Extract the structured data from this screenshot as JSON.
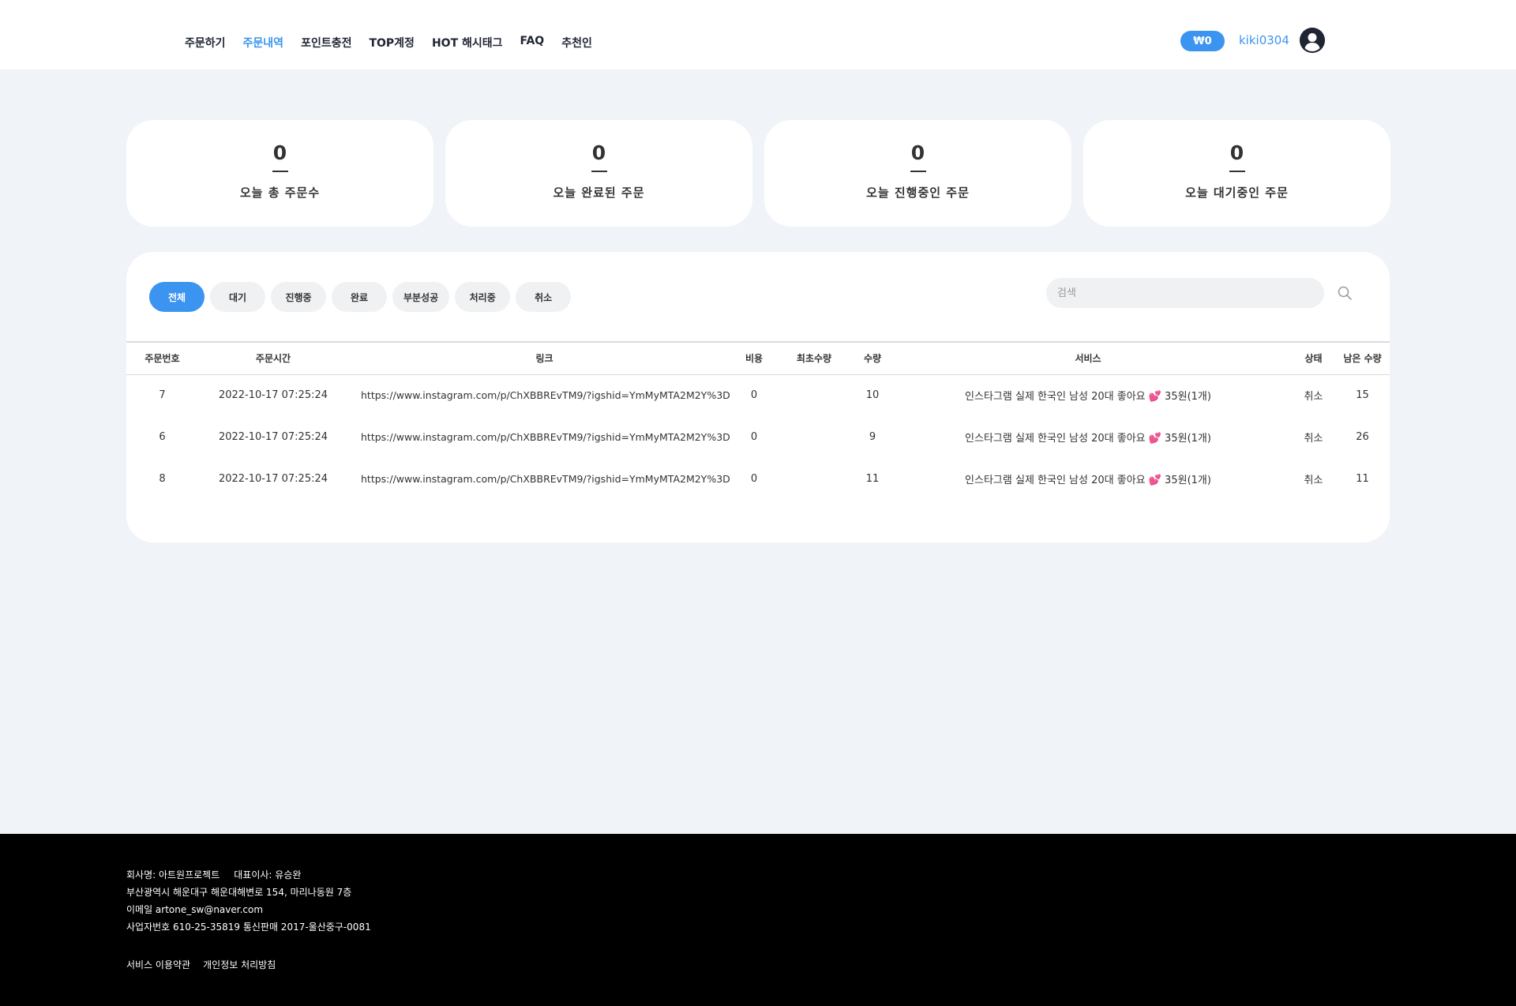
{
  "nav": {
    "items": [
      {
        "label": "주문하기",
        "active": false
      },
      {
        "label": "주문내역",
        "active": true
      },
      {
        "label": "포인트충전",
        "active": false
      },
      {
        "label": "TOP계정",
        "active": false
      },
      {
        "label": "HOT 해시태그",
        "active": false
      },
      {
        "label": "FAQ",
        "active": false
      },
      {
        "label": "추천인",
        "active": false
      }
    ]
  },
  "user": {
    "balance": "₩0",
    "username": "kiki0304",
    "avatar_icon": "user-circle-icon"
  },
  "stats": [
    {
      "value": "0",
      "label": "오늘 총 주문수"
    },
    {
      "value": "0",
      "label": "오늘 완료된 주문"
    },
    {
      "value": "0",
      "label": "오늘 진행중인 주문"
    },
    {
      "value": "0",
      "label": "오늘 대기중인 주문"
    }
  ],
  "filters": {
    "chips": [
      "전체",
      "대기",
      "진행중",
      "완료",
      "부분성공",
      "처리중",
      "취소"
    ],
    "active_index": 0
  },
  "search": {
    "placeholder": "검색",
    "value": "",
    "icon": "search-icon"
  },
  "table": {
    "columns": [
      "주문번호",
      "주문시간",
      "링크",
      "비용",
      "최초수량",
      "수량",
      "서비스",
      "상태",
      "남은 수량"
    ],
    "rows": [
      {
        "id": "7",
        "time": "2022-10-17 07:25:24",
        "link": "https://www.instagram.com/p/ChXBBREvTM9/?igshid=YmMyMTA2M2Y%3D",
        "cost": "0",
        "initial": "",
        "qty": "10",
        "service": "인스타그램 실제 한국인 남성 20대 좋아요 💕 35원(1개)",
        "status": "취소",
        "remaining": "15"
      },
      {
        "id": "6",
        "time": "2022-10-17 07:25:24",
        "link": "https://www.instagram.com/p/ChXBBREvTM9/?igshid=YmMyMTA2M2Y%3D",
        "cost": "0",
        "initial": "",
        "qty": "9",
        "service": "인스타그램 실제 한국인 남성 20대 좋아요 💕 35원(1개)",
        "status": "취소",
        "remaining": "26"
      },
      {
        "id": "8",
        "time": "2022-10-17 07:25:24",
        "link": "https://www.instagram.com/p/ChXBBREvTM9/?igshid=YmMyMTA2M2Y%3D",
        "cost": "0",
        "initial": "",
        "qty": "11",
        "service": "인스타그램 실제 한국인 남성 20대 좋아요 💕 35원(1개)",
        "status": "취소",
        "remaining": "11"
      }
    ]
  },
  "footer": {
    "company": "회사명: 아트원프로젝트",
    "ceo": "대표이사: 유승완",
    "address": "부산광역시 해운대구 해운대해변로 154, 마리나동원 7층",
    "email": "이메일 artone_sw@naver.com",
    "business": "사업자번호 610-25-35819 통신판매 2017-울산중구-0081",
    "links": [
      "서비스 이용약관",
      "개인정보 처리방침"
    ]
  },
  "colors": {
    "accent": "#3b95f0",
    "background": "#f0f3f7",
    "footer": "#000000"
  }
}
